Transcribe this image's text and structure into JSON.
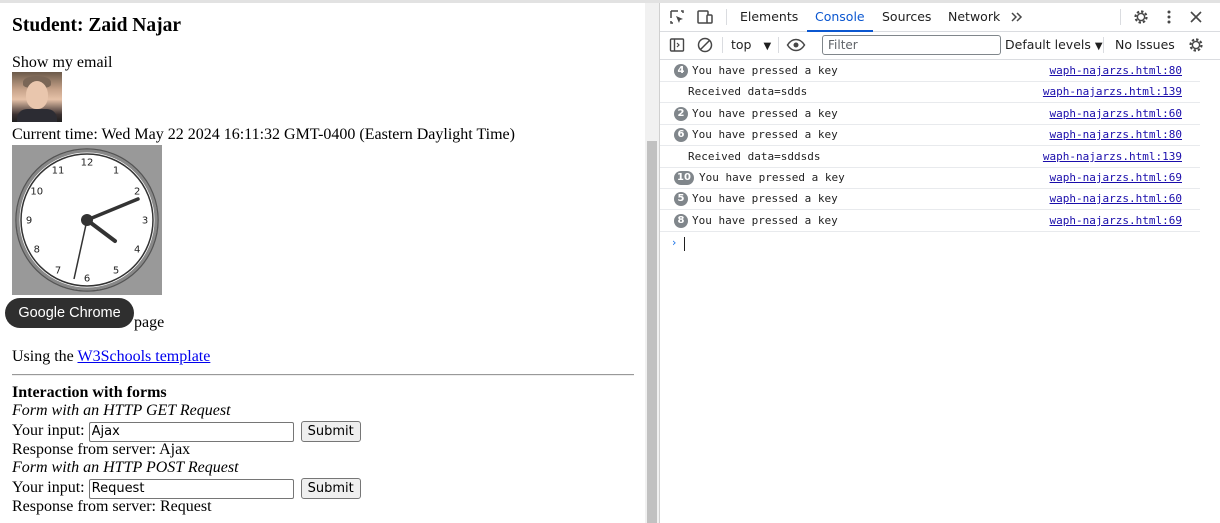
{
  "page": {
    "title": "Student: Zaid Najar",
    "email_toggle": "Show my email",
    "current_time": "Current time: Wed May 22 2024 16:11:32 GMT-0400 (Eastern Daylight Time)",
    "partial_text": "page",
    "using_prefix": "Using the ",
    "using_link": "W3Schools template",
    "interaction_heading": "Interaction with forms",
    "get_form": {
      "caption": "Form with an HTTP GET Request",
      "label": "Your input:",
      "value": "Ajax",
      "submit": "Submit",
      "response": "Response from server: Ajax"
    },
    "post_form": {
      "caption": "Form with an HTTP POST Request",
      "label": "Your input:",
      "value": "Request",
      "submit": "Submit",
      "response": "Response from server: Request"
    },
    "clock_numbers": [
      "12",
      "1",
      "2",
      "3",
      "4",
      "5",
      "6",
      "7",
      "8",
      "9",
      "10",
      "11"
    ]
  },
  "tooltip": "Google Chrome",
  "devtools": {
    "tabs": [
      "Elements",
      "Console",
      "Sources",
      "Network"
    ],
    "active_tab": "Console",
    "context": "top",
    "filter_placeholder": "Filter",
    "levels": "Default levels",
    "issues": "No Issues",
    "messages": [
      {
        "count": "4",
        "text": "You have pressed a key",
        "source": "waph-najarzs.html:80"
      },
      {
        "count": "",
        "text": "Received data=sdds",
        "source": "waph-najarzs.html:139"
      },
      {
        "count": "2",
        "text": "You have pressed a key",
        "source": "waph-najarzs.html:60"
      },
      {
        "count": "6",
        "text": "You have pressed a key",
        "source": "waph-najarzs.html:80"
      },
      {
        "count": "",
        "text": "Received data=sddsds",
        "source": "waph-najarzs.html:139"
      },
      {
        "count": "10",
        "text": "You have pressed a key",
        "source": "waph-najarzs.html:69"
      },
      {
        "count": "5",
        "text": "You have pressed a key",
        "source": "waph-najarzs.html:60"
      },
      {
        "count": "8",
        "text": "You have pressed a key",
        "source": "waph-najarzs.html:69"
      }
    ]
  },
  "colors": {
    "accent": "#0b57d0",
    "link": "#1a0dab",
    "badge": "#80868b",
    "clock_bg": "#999999"
  }
}
